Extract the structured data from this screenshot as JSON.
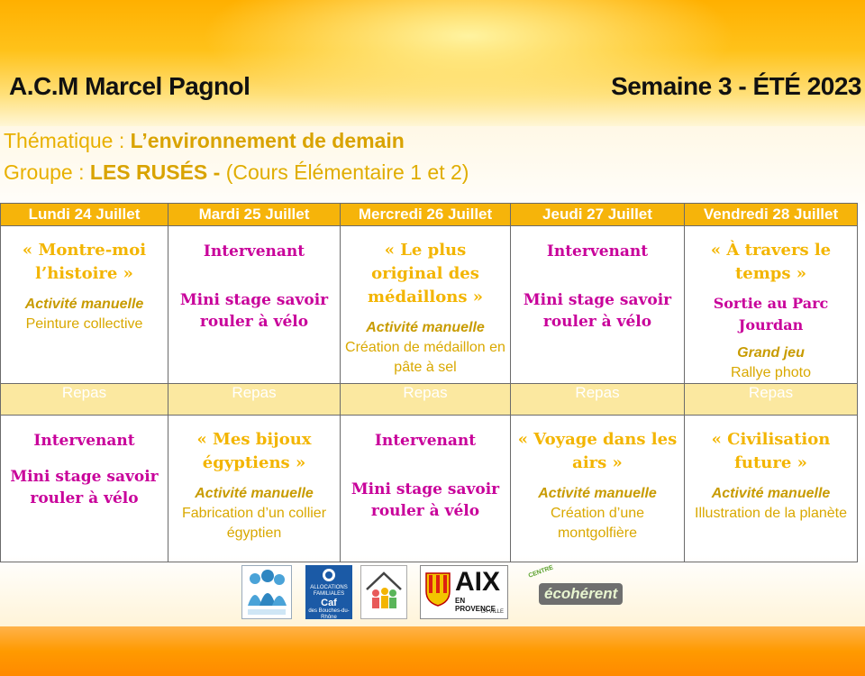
{
  "header": {
    "center_name": "A.C.M Marcel Pagnol",
    "week": "Semaine 3 - ÉTÉ 2023"
  },
  "theme": {
    "label": "Thématique :",
    "value": "L’environnement de demain"
  },
  "group": {
    "label": "Groupe :",
    "name": "LES RUSÉS -",
    "detail": "(Cours Élémentaire 1 et 2)"
  },
  "days": [
    "Lundi 24 Juillet",
    "Mardi 25 Juillet",
    "Mercredi 26 Juillet",
    "Jeudi 27 Juillet",
    "Vendredi 28 Juillet"
  ],
  "morning": [
    {
      "title": "« Montre-moi l’histoire »",
      "type": "Activité manuelle",
      "desc": "Peinture collective"
    },
    {
      "title": "Intervenant",
      "subtitle": "Mini stage savoir rouler à vélo"
    },
    {
      "title": "« Le plus original des médaillons »",
      "type": "Activité manuelle",
      "desc": "Création de médaillon en pâte à sel"
    },
    {
      "title": "Intervenant",
      "subtitle": "Mini stage savoir rouler à vélo"
    },
    {
      "title": "« À travers le temps »",
      "subtitle": "Sortie au Parc Jourdan",
      "type": "Grand jeu",
      "desc": "Rallye photo"
    }
  ],
  "lunch_label": "Repas",
  "afternoon": [
    {
      "title": "Intervenant",
      "subtitle": "Mini stage savoir rouler à vélo"
    },
    {
      "title": "« Mes bijoux égyptiens »",
      "type": "Activité manuelle",
      "desc": "Fabrication d’un collier égyptien"
    },
    {
      "title": "Intervenant",
      "subtitle": "Mini stage savoir rouler à vélo"
    },
    {
      "title": "« Voyage dans les airs »",
      "type": "Activité manuelle",
      "desc": "Création d’une montgolfière"
    },
    {
      "title": "« Civilisation future »",
      "type": "Activité manuelle",
      "desc": "Illustration de la planète"
    }
  ],
  "logos": {
    "aix_main": "AIX",
    "aix_sub": "EN PROVENCE",
    "aix_tag": "LA VILLE",
    "eco_tag": "CENTRE",
    "eco_name": "écohérent",
    "caf_line1": "ALLOCATIONS FAMILIALES",
    "caf_line2": "Caf",
    "caf_line3": "des Bouches-du-Rhône"
  }
}
